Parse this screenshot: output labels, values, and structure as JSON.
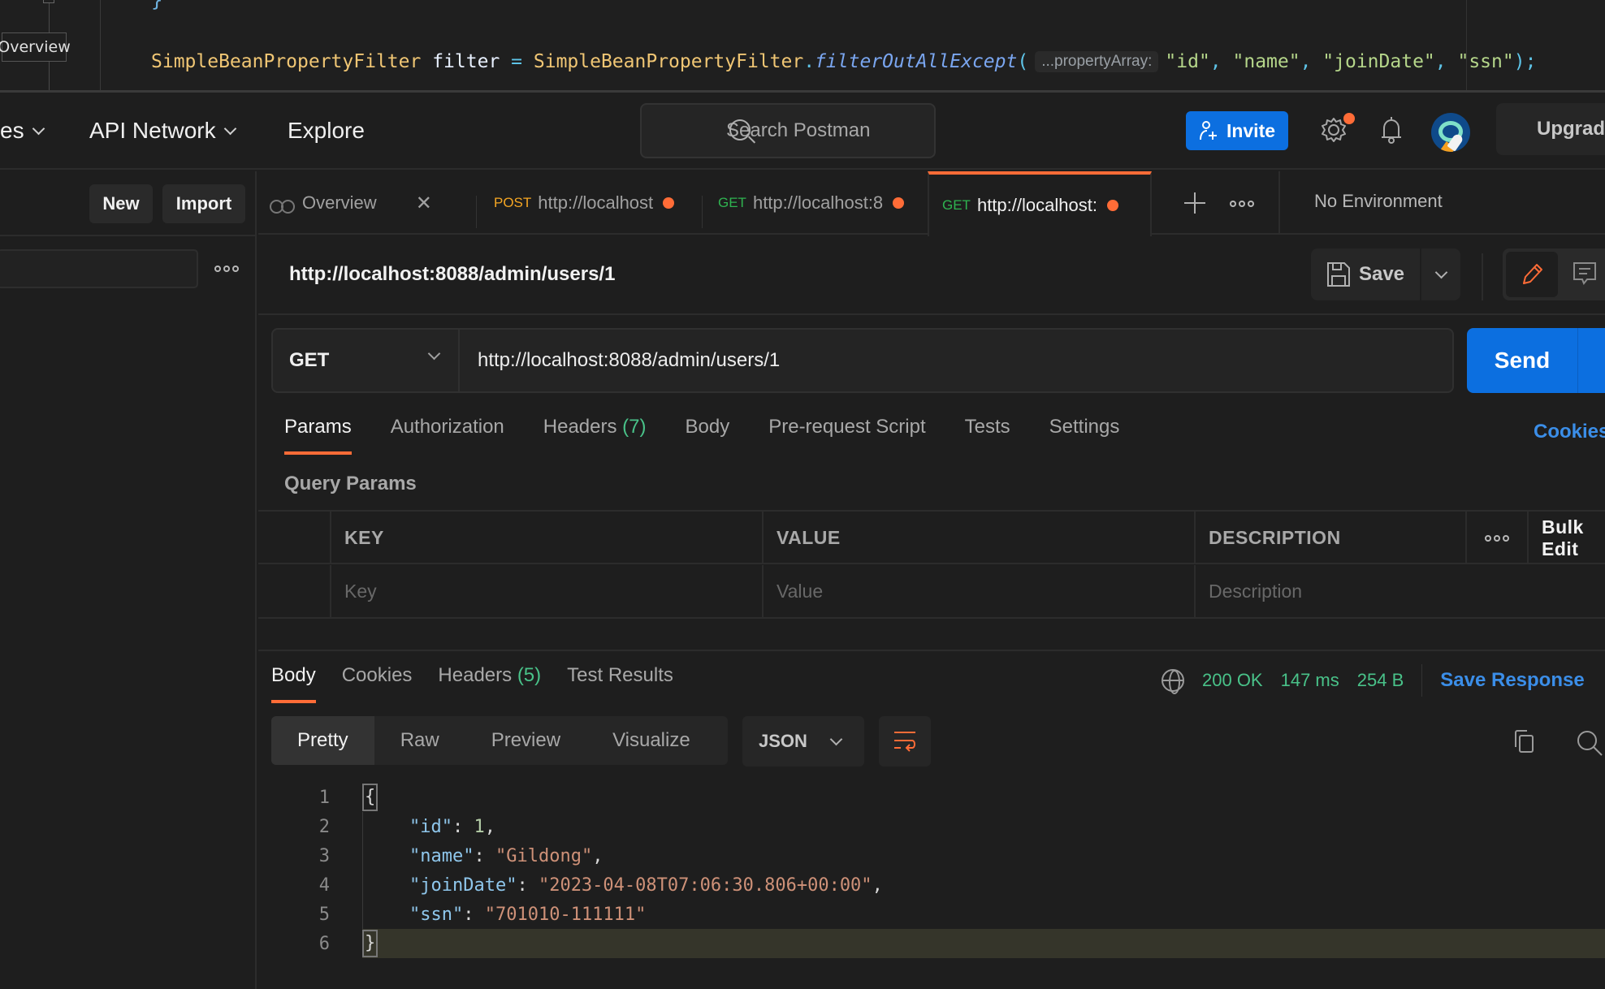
{
  "ide": {
    "tooltip": "Overview",
    "code_line": {
      "type": "SimpleBeanPropertyFilter",
      "var": "filter",
      "op": "=",
      "class": "SimpleBeanPropertyFilter",
      "dot": ".",
      "method": "filterOutAllExcept",
      "open": "(",
      "hint": "...propertyArray:",
      "args": [
        "\"id\"",
        "\"name\"",
        "\"joinDate\"",
        "\"ssn\""
      ],
      "close": ");"
    }
  },
  "topbar": {
    "nav": [
      {
        "label": "es",
        "has_dropdown": true
      },
      {
        "label": "API Network",
        "has_dropdown": true
      },
      {
        "label": "Explore",
        "has_dropdown": false
      }
    ],
    "search_placeholder": "Search Postman",
    "invite_label": "Invite",
    "upgrade_label": "Upgrade",
    "settings_has_notification": true,
    "colors": {
      "accent": "#ff6c37",
      "primary": "#0c6fe0",
      "success": "#49c289",
      "link": "#3b8ee8"
    }
  },
  "sidebar": {
    "new_label": "New",
    "import_label": "Import"
  },
  "tabs": {
    "items": [
      {
        "type": "overview",
        "label": "Overview",
        "closable": true
      },
      {
        "method": "POST",
        "label": "http://localhost",
        "unsaved": true,
        "method_color": "#f5a623"
      },
      {
        "method": "GET",
        "label": "http://localhost:8",
        "unsaved": true,
        "method_color": "#2fb350"
      },
      {
        "method": "GET",
        "label": "http://localhost:",
        "unsaved": true,
        "active": true,
        "method_color": "#2fb350"
      }
    ],
    "environment": "No Environment"
  },
  "request": {
    "title": "http://localhost:8088/admin/users/1",
    "save_label": "Save",
    "method": "GET",
    "url": "http://localhost:8088/admin/users/1",
    "send_label": "Send",
    "subtabs": [
      {
        "label": "Params",
        "active": true
      },
      {
        "label": "Authorization"
      },
      {
        "label": "Headers",
        "count": "(7)"
      },
      {
        "label": "Body"
      },
      {
        "label": "Pre-request Script"
      },
      {
        "label": "Tests"
      },
      {
        "label": "Settings"
      }
    ],
    "cookies_label": "Cookies",
    "query_params_label": "Query Params",
    "params_table": {
      "headers": [
        "KEY",
        "VALUE",
        "DESCRIPTION"
      ],
      "bulk_edit_label": "Bulk Edit",
      "placeholders": {
        "key": "Key",
        "value": "Value",
        "description": "Description"
      }
    }
  },
  "response": {
    "tabs": [
      {
        "label": "Body",
        "active": true
      },
      {
        "label": "Cookies"
      },
      {
        "label": "Headers",
        "count": "(5)"
      },
      {
        "label": "Test Results"
      }
    ],
    "status": "200 OK",
    "time": "147 ms",
    "size": "254 B",
    "save_response_label": "Save Response",
    "formats": [
      "Pretty",
      "Raw",
      "Preview",
      "Visualize"
    ],
    "active_format": "Pretty",
    "language": "JSON",
    "body_lines": [
      {
        "n": "1",
        "open": "{"
      },
      {
        "n": "2",
        "key": "\"id\"",
        "value": "1",
        "value_type": "number",
        "comma": ","
      },
      {
        "n": "3",
        "key": "\"name\"",
        "value": "\"Gildong\"",
        "value_type": "string",
        "comma": ","
      },
      {
        "n": "4",
        "key": "\"joinDate\"",
        "value": "\"2023-04-08T07:06:30.806+00:00\"",
        "value_type": "string",
        "comma": ","
      },
      {
        "n": "5",
        "key": "\"ssn\"",
        "value": "\"701010-111111\"",
        "value_type": "string",
        "comma": ""
      },
      {
        "n": "6",
        "close": "}"
      }
    ]
  }
}
